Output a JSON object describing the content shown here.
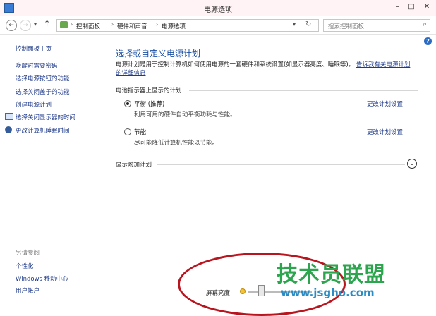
{
  "window": {
    "title": "电源选项"
  },
  "nav": {
    "breadcrumbs": [
      "控制面板",
      "硬件和声音",
      "电源选项"
    ],
    "search_placeholder": "搜索控制面板"
  },
  "sidebar": {
    "title": "控制面板主页",
    "items": [
      "唤醒时需要密码",
      "选择电源按钮的功能",
      "选择关闭盖子的功能",
      "创建电源计划",
      "选择关闭显示器的时间",
      "更改计算机睡眠时间"
    ],
    "see_also_title": "另请参阅",
    "see_also": [
      "个性化",
      "Windows 移动中心",
      "用户帐户"
    ]
  },
  "main": {
    "heading": "选择或自定义电源计划",
    "intro_text": "电源计划是用于控制计算机如何使用电源的一套硬件和系统设置(如显示器亮度、睡眠等)。",
    "intro_link": "告诉我有关电源计划的详细信息",
    "section_label": "电池指示器上显示的计划",
    "plans": [
      {
        "name": "平衡 (推荐)",
        "desc": "利用可用的硬件自动平衡功耗与性能。",
        "selected": true,
        "change_link": "更改计划设置"
      },
      {
        "name": "节能",
        "desc": "尽可能降低计算机性能以节能。",
        "selected": false,
        "change_link": "更改计划设置"
      }
    ],
    "extra_plans_label": "显示附加计划"
  },
  "bottom": {
    "brightness_label": "屏幕亮度:",
    "brightness_level": 0.2
  },
  "watermark": {
    "chars": "技术员联盟",
    "url": "www.jsgho.com"
  },
  "colors": {
    "accent": "#1a4ea1",
    "link": "#1f3a8a",
    "annotation": "#b8151f"
  }
}
